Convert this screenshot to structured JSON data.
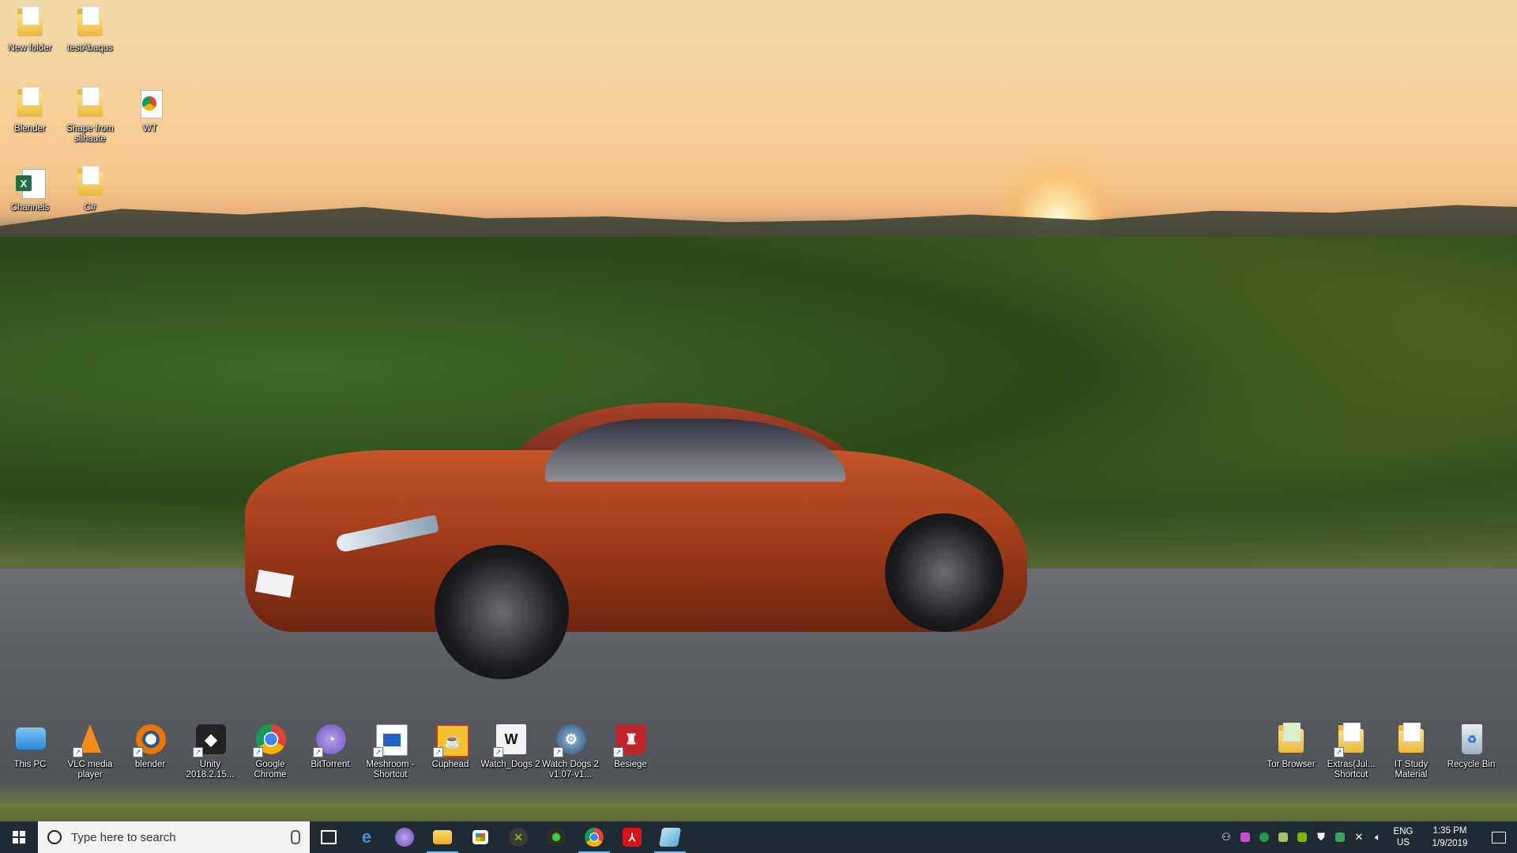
{
  "desktop": {
    "top_icons": [
      {
        "label": "New folder",
        "icon": "folder-icon"
      },
      {
        "label": "testAbaqus",
        "icon": "folder-icon"
      },
      {
        "label": "Blender",
        "icon": "folder-icon"
      },
      {
        "label": "Shape from silhaute",
        "icon": "folder-icon"
      },
      {
        "label": "WT",
        "icon": "chrome-file-icon"
      },
      {
        "label": "Channels",
        "icon": "excel-icon"
      },
      {
        "label": "C#",
        "icon": "folder-icon"
      }
    ],
    "bottom_left_icons": [
      {
        "label": "This PC",
        "icon": "this-pc-icon"
      },
      {
        "label": "VLC media player",
        "icon": "vlc-icon"
      },
      {
        "label": "blender",
        "icon": "blender-icon"
      },
      {
        "label": "Unity 2018.2.15...",
        "icon": "unity-icon"
      },
      {
        "label": "Google Chrome",
        "icon": "chrome-icon"
      },
      {
        "label": "BitTorrent",
        "icon": "bittorrent-icon"
      },
      {
        "label": "Meshroom - Shortcut",
        "icon": "meshroom-icon"
      },
      {
        "label": "Cuphead",
        "icon": "cuphead-icon"
      },
      {
        "label": "Watch_Dogs 2",
        "icon": "watchdogs2-icon"
      },
      {
        "label": "Watch Dogs 2 v1.07-v1...",
        "icon": "watchdogs-update-icon"
      },
      {
        "label": "Besiege",
        "icon": "besiege-icon"
      }
    ],
    "bottom_right_icons": [
      {
        "label": "Tor Browser",
        "icon": "tor-folder-icon"
      },
      {
        "label": "Extras(Jul... Shortcut",
        "icon": "folder-shortcut-icon"
      },
      {
        "label": "IT Study Material",
        "icon": "folder-icon"
      },
      {
        "label": "Recycle Bin",
        "icon": "recycle-bin-icon"
      }
    ]
  },
  "taskbar": {
    "search_placeholder": "Type here to search",
    "pinned": [
      {
        "name": "task-view",
        "icon": "task-view-icon"
      },
      {
        "name": "edge",
        "icon": "edge-icon"
      },
      {
        "name": "bittorrent",
        "icon": "bittorrent-icon"
      },
      {
        "name": "file-explorer",
        "icon": "file-explorer-icon",
        "active": true
      },
      {
        "name": "store",
        "icon": "store-icon"
      },
      {
        "name": "xbox",
        "icon": "xbox-icon"
      },
      {
        "name": "razer",
        "icon": "razer-icon"
      },
      {
        "name": "chrome",
        "icon": "chrome-icon",
        "active": true
      },
      {
        "name": "acrobat",
        "icon": "acrobat-icon"
      },
      {
        "name": "notepad",
        "icon": "notepad-icon",
        "active": true
      }
    ],
    "tray": {
      "language_line1": "ENG",
      "language_line2": "US",
      "time": "1:35 PM",
      "date": "1/9/2019"
    }
  },
  "colors": {
    "taskbar": "#1f2a33",
    "accent": "#76b9ed"
  }
}
